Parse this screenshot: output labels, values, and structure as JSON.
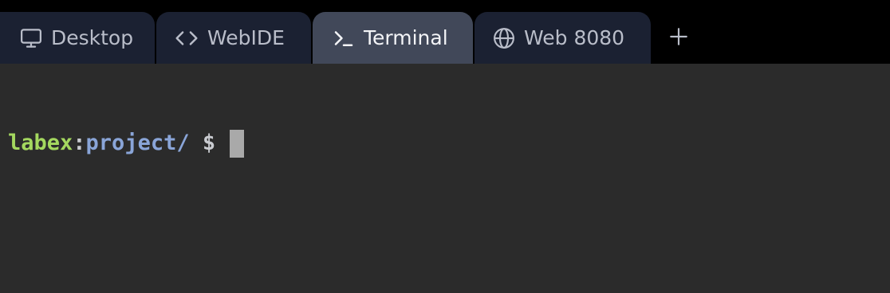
{
  "tabs": [
    {
      "id": "desktop",
      "label": "Desktop",
      "icon": "monitor-icon",
      "active": false
    },
    {
      "id": "webide",
      "label": "WebIDE",
      "icon": "code-icon",
      "active": false
    },
    {
      "id": "terminal",
      "label": "Terminal",
      "icon": "terminal-icon",
      "active": true
    },
    {
      "id": "web8080",
      "label": "Web 8080",
      "icon": "globe-icon",
      "active": false
    }
  ],
  "add_tab": {
    "icon": "plus-icon"
  },
  "terminal": {
    "user": "labex",
    "separator": ":",
    "path": "project/",
    "symbol": "$"
  },
  "colors": {
    "tabbar_bg": "#000000",
    "tab_bg": "#1b2132",
    "tab_active_bg": "#414859",
    "terminal_bg": "#2b2b2b",
    "prompt_user": "#a4d85f",
    "prompt_path": "#8aa5d8",
    "cursor": "#a9a9a9"
  }
}
